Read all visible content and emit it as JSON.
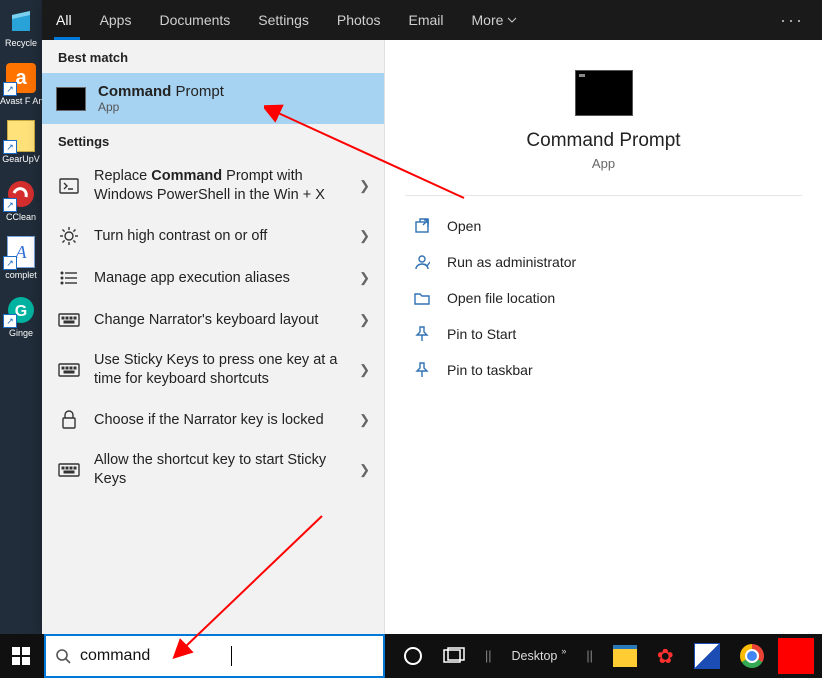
{
  "desktop_icons": [
    {
      "label": "Recycle",
      "color": "#00a2d9"
    },
    {
      "label": "Avast F\nAntivir",
      "color": "#ff7300"
    },
    {
      "label": "GearUpV",
      "color": "#ffd24d"
    },
    {
      "label": "CClean",
      "color": "#d42e2e"
    },
    {
      "label": "complet",
      "color": "#2d6fd8"
    },
    {
      "label": "Ginge",
      "color": "#00b3a0"
    }
  ],
  "tabs": [
    "All",
    "Apps",
    "Documents",
    "Settings",
    "Photos",
    "Email",
    "More"
  ],
  "active_tab": 0,
  "best_match_header": "Best match",
  "best_match": {
    "title_bold": "Command",
    "title_rest": " Prompt",
    "subtitle": "App"
  },
  "settings_header": "Settings",
  "settings": [
    {
      "icon": "ps",
      "label_pre": "Replace ",
      "label_bold": "Command",
      "label_post": " Prompt with Windows PowerShell in the Win + X"
    },
    {
      "icon": "sun",
      "label": "Turn high contrast on or off"
    },
    {
      "icon": "list",
      "label": "Manage app execution aliases"
    },
    {
      "icon": "kbd",
      "label": "Change Narrator's keyboard layout"
    },
    {
      "icon": "kbd",
      "label": "Use Sticky Keys to press one key at a time for keyboard shortcuts"
    },
    {
      "icon": "lock",
      "label": "Choose if the Narrator key is locked"
    },
    {
      "icon": "kbd",
      "label": "Allow the shortcut key to start Sticky Keys"
    }
  ],
  "preview": {
    "title": "Command Prompt",
    "subtitle": "App"
  },
  "actions": [
    {
      "icon": "open",
      "label": "Open"
    },
    {
      "icon": "admin",
      "label": "Run as administrator"
    },
    {
      "icon": "folder",
      "label": "Open file location"
    },
    {
      "icon": "pin",
      "label": "Pin to Start"
    },
    {
      "icon": "pin",
      "label": "Pin to taskbar"
    }
  ],
  "search": {
    "value": "command"
  },
  "taskbar": {
    "desktop_label": "Desktop"
  }
}
